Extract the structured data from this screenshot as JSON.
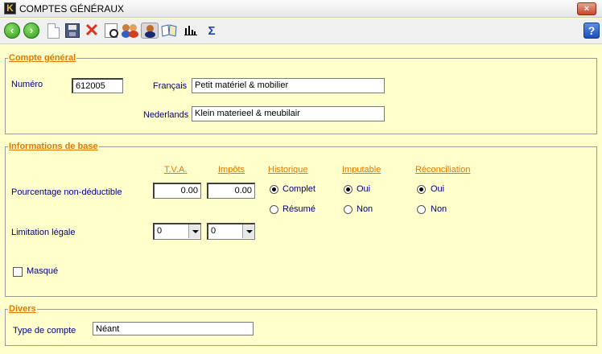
{
  "window": {
    "title": "COMPTES GÉNÉRAUX",
    "logo_letter": "K",
    "close_glyph": "×"
  },
  "toolbar": {
    "icons": [
      "back-icon",
      "forward-icon",
      "new-document-icon",
      "save-icon",
      "delete-icon",
      "preview-icon",
      "users-icon",
      "user-icon",
      "book-icon",
      "chart-icon",
      "sum-icon",
      "help-icon"
    ],
    "sum_glyph": "Σ",
    "help_glyph": "?"
  },
  "compte_general": {
    "legend": "Compte général",
    "numero_label": "Numéro",
    "numero_value": "612005",
    "francais_label": "Français",
    "francais_value": "Petit matériel & mobilier",
    "nederlands_label": "Nederlands",
    "nederlands_value": "Klein materieel & meubilair"
  },
  "informations": {
    "legend": "Informations de base",
    "col_tva": "T.V.A.",
    "col_impots": "Impôts",
    "col_historique": "Historique",
    "col_imputable": "Imputable",
    "col_reconciliation": "Réconciliation",
    "pourcentage_label": "Pourcentage non-déductible",
    "tva_value": "0.00",
    "impots_value": "0.00",
    "historique_options": [
      "Complet",
      "Résumé"
    ],
    "historique_selected": "Complet",
    "imputable_options": [
      "Oui",
      "Non"
    ],
    "imputable_selected": "Oui",
    "reconciliation_options": [
      "Oui",
      "Non"
    ],
    "reconciliation_selected": "Oui",
    "limitation_label": "Limitation légale",
    "limitation_tva": "0",
    "limitation_impots": "0",
    "masque_label": "Masqué",
    "masque_checked": false
  },
  "divers": {
    "legend": "Divers",
    "type_label": "Type de compte",
    "type_value": "Néant"
  }
}
